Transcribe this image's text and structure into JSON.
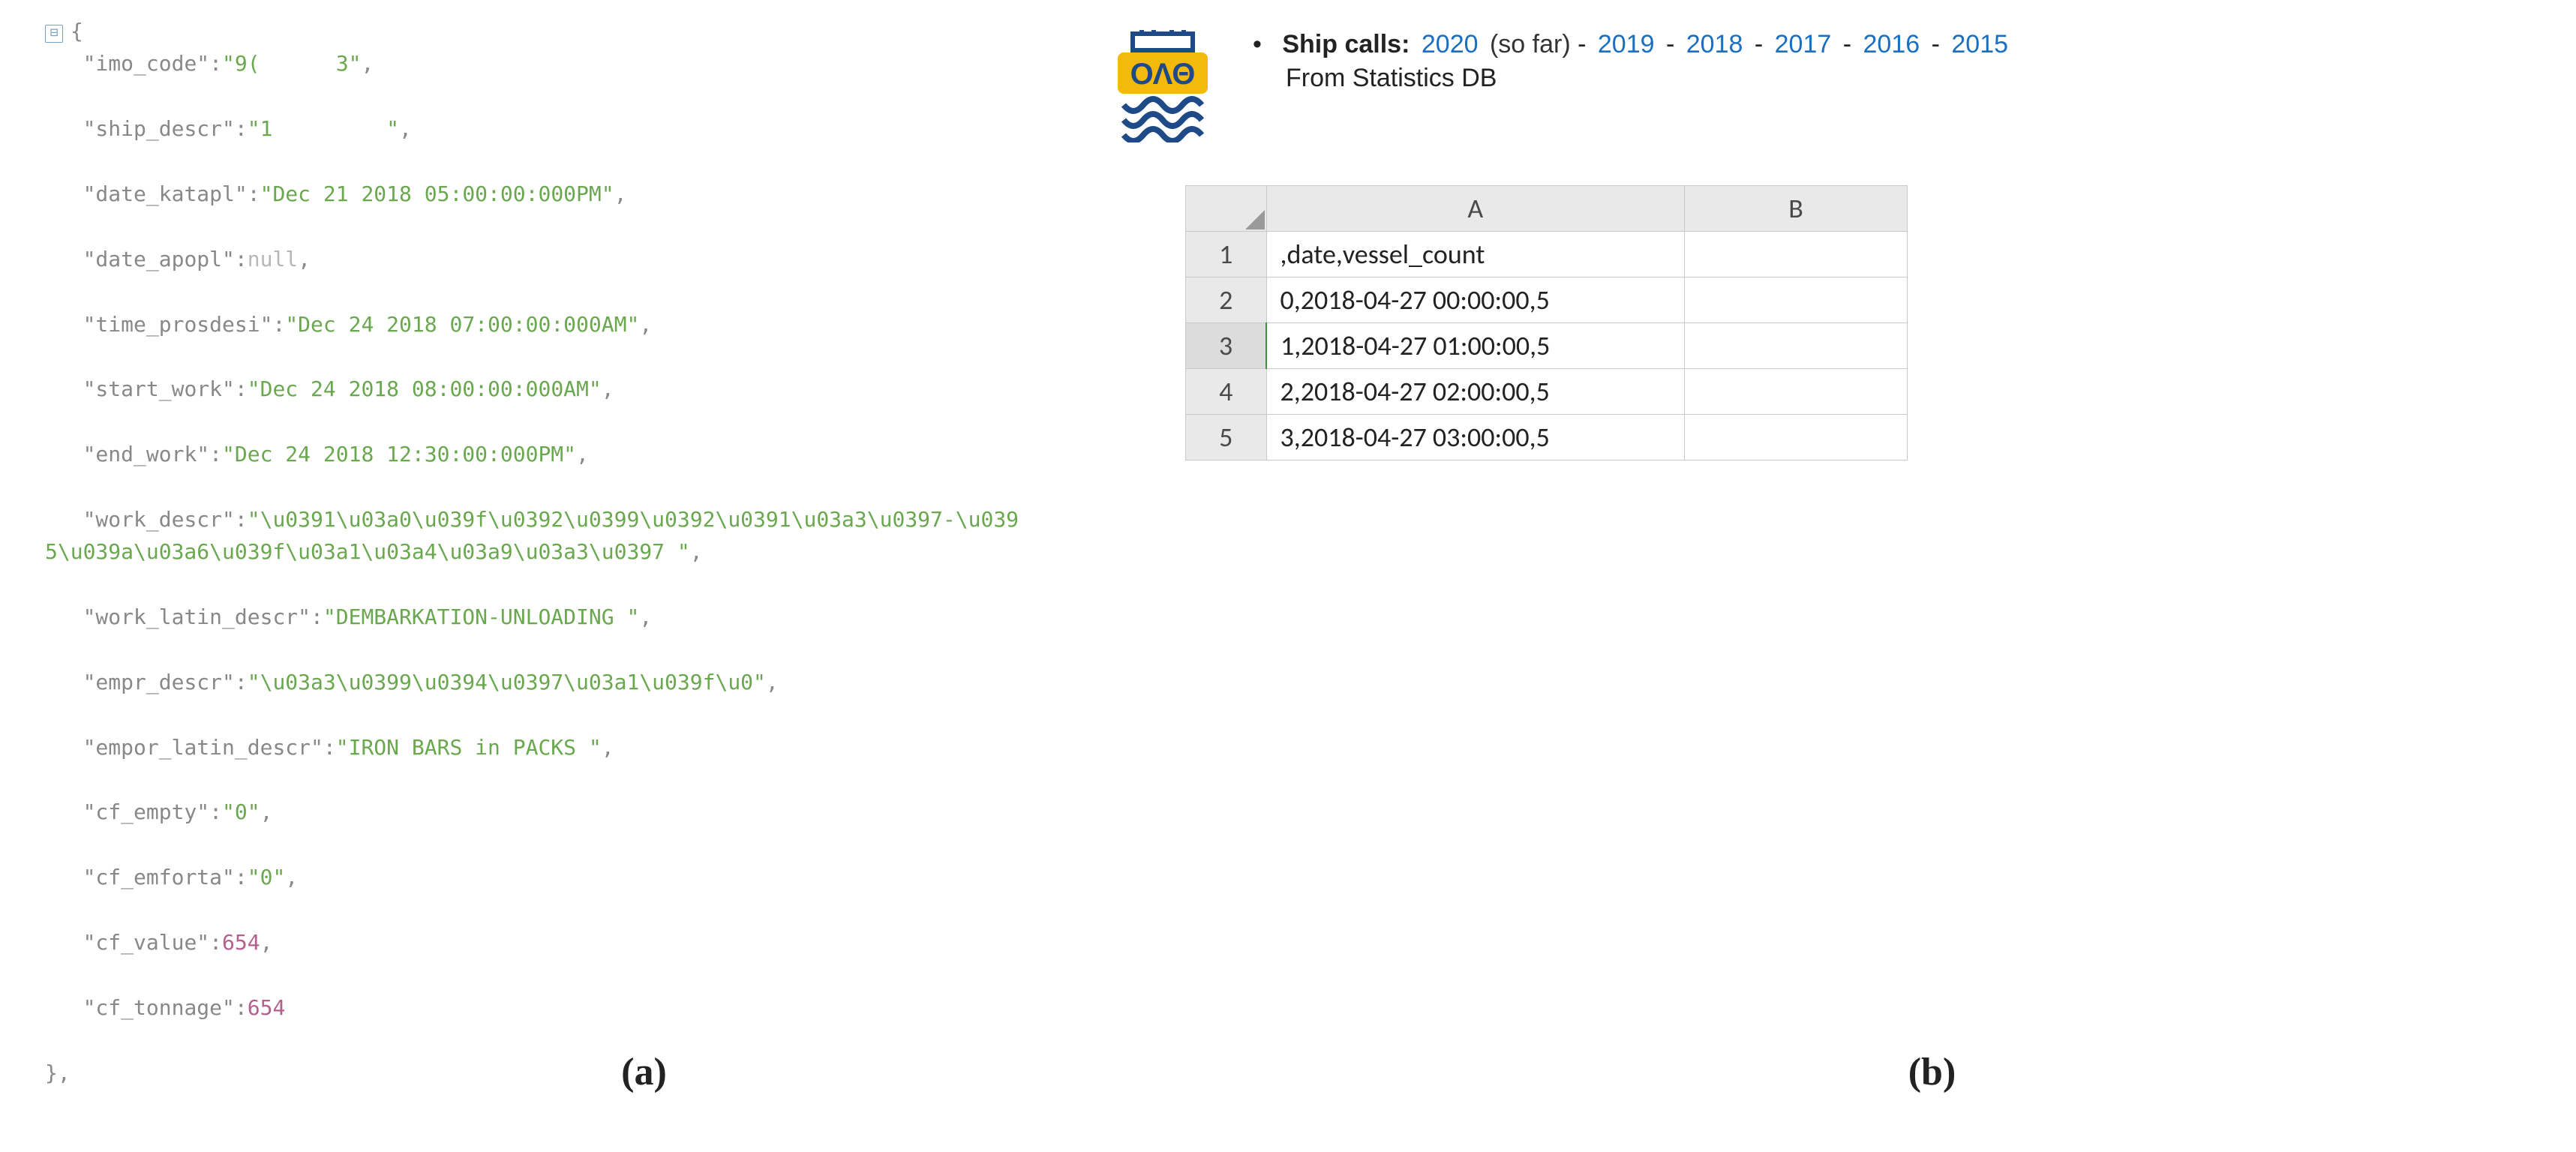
{
  "panel_a": {
    "toggle_glyph": "⊟",
    "open_brace": "{",
    "close_brace": "},",
    "lines": [
      {
        "key": "imo_code",
        "type": "str",
        "value": "9(      3"
      },
      {
        "key": "ship_descr",
        "type": "str",
        "value": "1         "
      },
      {
        "key": "date_katapl",
        "type": "str",
        "value": "Dec 21 2018 05:00:00:000PM"
      },
      {
        "key": "date_apopl",
        "type": "null",
        "value": "null"
      },
      {
        "key": "time_prosdesi",
        "type": "str",
        "value": "Dec 24 2018 07:00:00:000AM"
      },
      {
        "key": "start_work",
        "type": "str",
        "value": "Dec 24 2018 08:00:00:000AM"
      },
      {
        "key": "end_work",
        "type": "str",
        "value": "Dec 24 2018 12:30:00:000PM"
      },
      {
        "key": "work_descr",
        "type": "str",
        "value": "\\u0391\\u03a0\\u039f\\u0392\\u0399\\u0392\\u0391\\u03a3\\u0397-\\u0395\\u039a\\u03a6\\u039f\\u03a1\\u03a4\\u03a9\\u03a3\\u0397 "
      },
      {
        "key": "work_latin_descr",
        "type": "str",
        "value": "DEMBARKATION-UNLOADING "
      },
      {
        "key": "empr_descr",
        "type": "str",
        "value": "\\u03a3\\u0399\\u0394\\u0397\\u03a1\\u039f\\u0"
      },
      {
        "key": "empor_latin_descr",
        "type": "str",
        "value": "IRON BARS in PACKS "
      },
      {
        "key": "cf_empty",
        "type": "str",
        "value": "0"
      },
      {
        "key": "cf_emforta",
        "type": "str",
        "value": "0"
      },
      {
        "key": "cf_value",
        "type": "num",
        "value": "654"
      },
      {
        "key": "cf_tonnage",
        "type": "num",
        "value": "654"
      }
    ]
  },
  "panel_b": {
    "ship_calls_label": "Ship calls:",
    "years": [
      "2020",
      "2019",
      "2018",
      "2017",
      "2016",
      "2015"
    ],
    "so_far": "(so far)",
    "dash": "-",
    "from_db": "From Statistics DB",
    "columns": [
      "A",
      "B"
    ],
    "rows": [
      {
        "n": "1",
        "a": ",date,vessel_count",
        "b": ""
      },
      {
        "n": "2",
        "a": "0,2018-04-27 00:00:00,5",
        "b": ""
      },
      {
        "n": "3",
        "a": "1,2018-04-27 01:00:00,5",
        "b": ""
      },
      {
        "n": "4",
        "a": "2,2018-04-27 02:00:00,5",
        "b": ""
      },
      {
        "n": "5",
        "a": "3,2018-04-27 03:00:00,5",
        "b": ""
      }
    ],
    "selected_row": "3"
  },
  "labels": {
    "a": "(a)",
    "b": "(b)"
  }
}
